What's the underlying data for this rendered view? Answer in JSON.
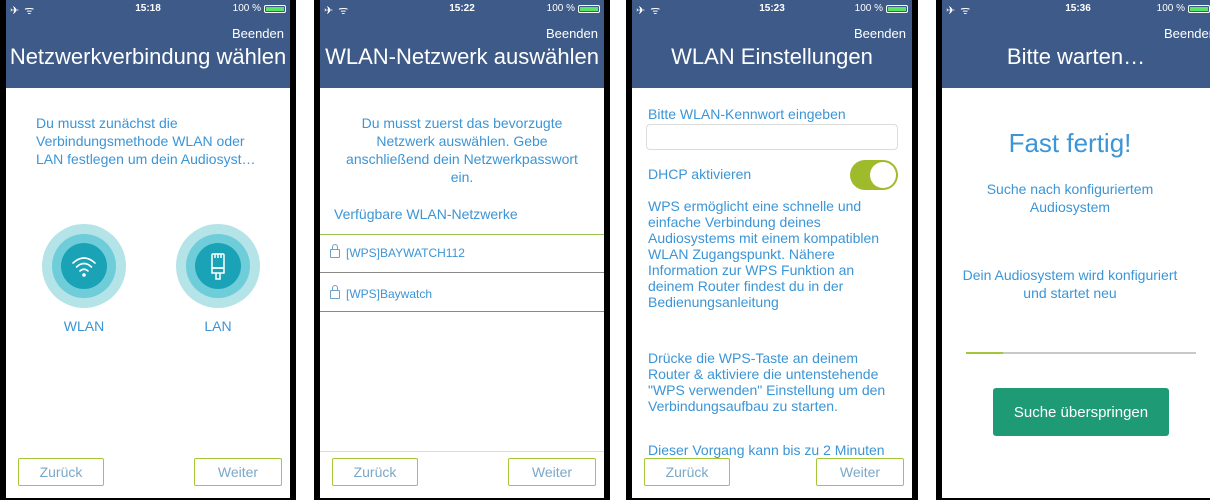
{
  "status": {
    "time1": "15:18",
    "time2": "15:22",
    "time3": "15:23",
    "time4": "15:36",
    "battery": "100 %"
  },
  "common": {
    "beenden": "Beenden",
    "back": "Zurück",
    "next": "Weiter"
  },
  "screen1": {
    "title": "Netzwerkverbindung wählen",
    "description": "Du musst zunächst die Verbindungsmethode WLAN oder LAN festlegen um dein Audiosyst…",
    "wlan_label": "WLAN",
    "lan_label": "LAN"
  },
  "screen2": {
    "title": "WLAN-Netzwerk auswählen",
    "description": "Du musst zuerst das bevorzugte Netzwerk  auswählen. Gebe anschließend dein Netzwerkpasswort ein.",
    "networks_heading": "Verfügbare WLAN-Netzwerke",
    "networks": [
      "[WPS]BAYWATCH112",
      "[WPS]Baywatch"
    ]
  },
  "screen3": {
    "title": "WLAN Einstellungen",
    "password_label": "Bitte WLAN-Kennwort eingeben",
    "password_value": "",
    "dhcp_label": "DHCP aktivieren",
    "dhcp_on": true,
    "wps_info": "WPS ermöglicht eine schnelle und einfache Verbindung deines Audiosystems mit einem kompatiblen WLAN Zugangspunkt. Nähere Information zur WPS Funktion an deinem Router findest du in der Bedienungsanleitung",
    "wps_instruction": " Drücke die WPS-Taste an deinem Router & aktiviere die untenstehende \"WPS verwenden\" Einstellung um den Verbindungsaufbau zu starten.",
    "wps_duration": " Dieser Vorgang kann bis zu 2 Minuten"
  },
  "screen4": {
    "title": "Bitte warten…",
    "heading": "Fast fertig!",
    "status1": "Suche nach konfiguriertem Audiosystem",
    "status2": "Dein Audiosystem wird konfiguriert und startet neu",
    "progress": 0.16,
    "skip_button": "Suche überspringen"
  },
  "colors": {
    "header": "#3d5a88",
    "text_blue": "#3b95d6",
    "accent_green": "#a4c73a",
    "skip_button": "#1e9a74"
  }
}
